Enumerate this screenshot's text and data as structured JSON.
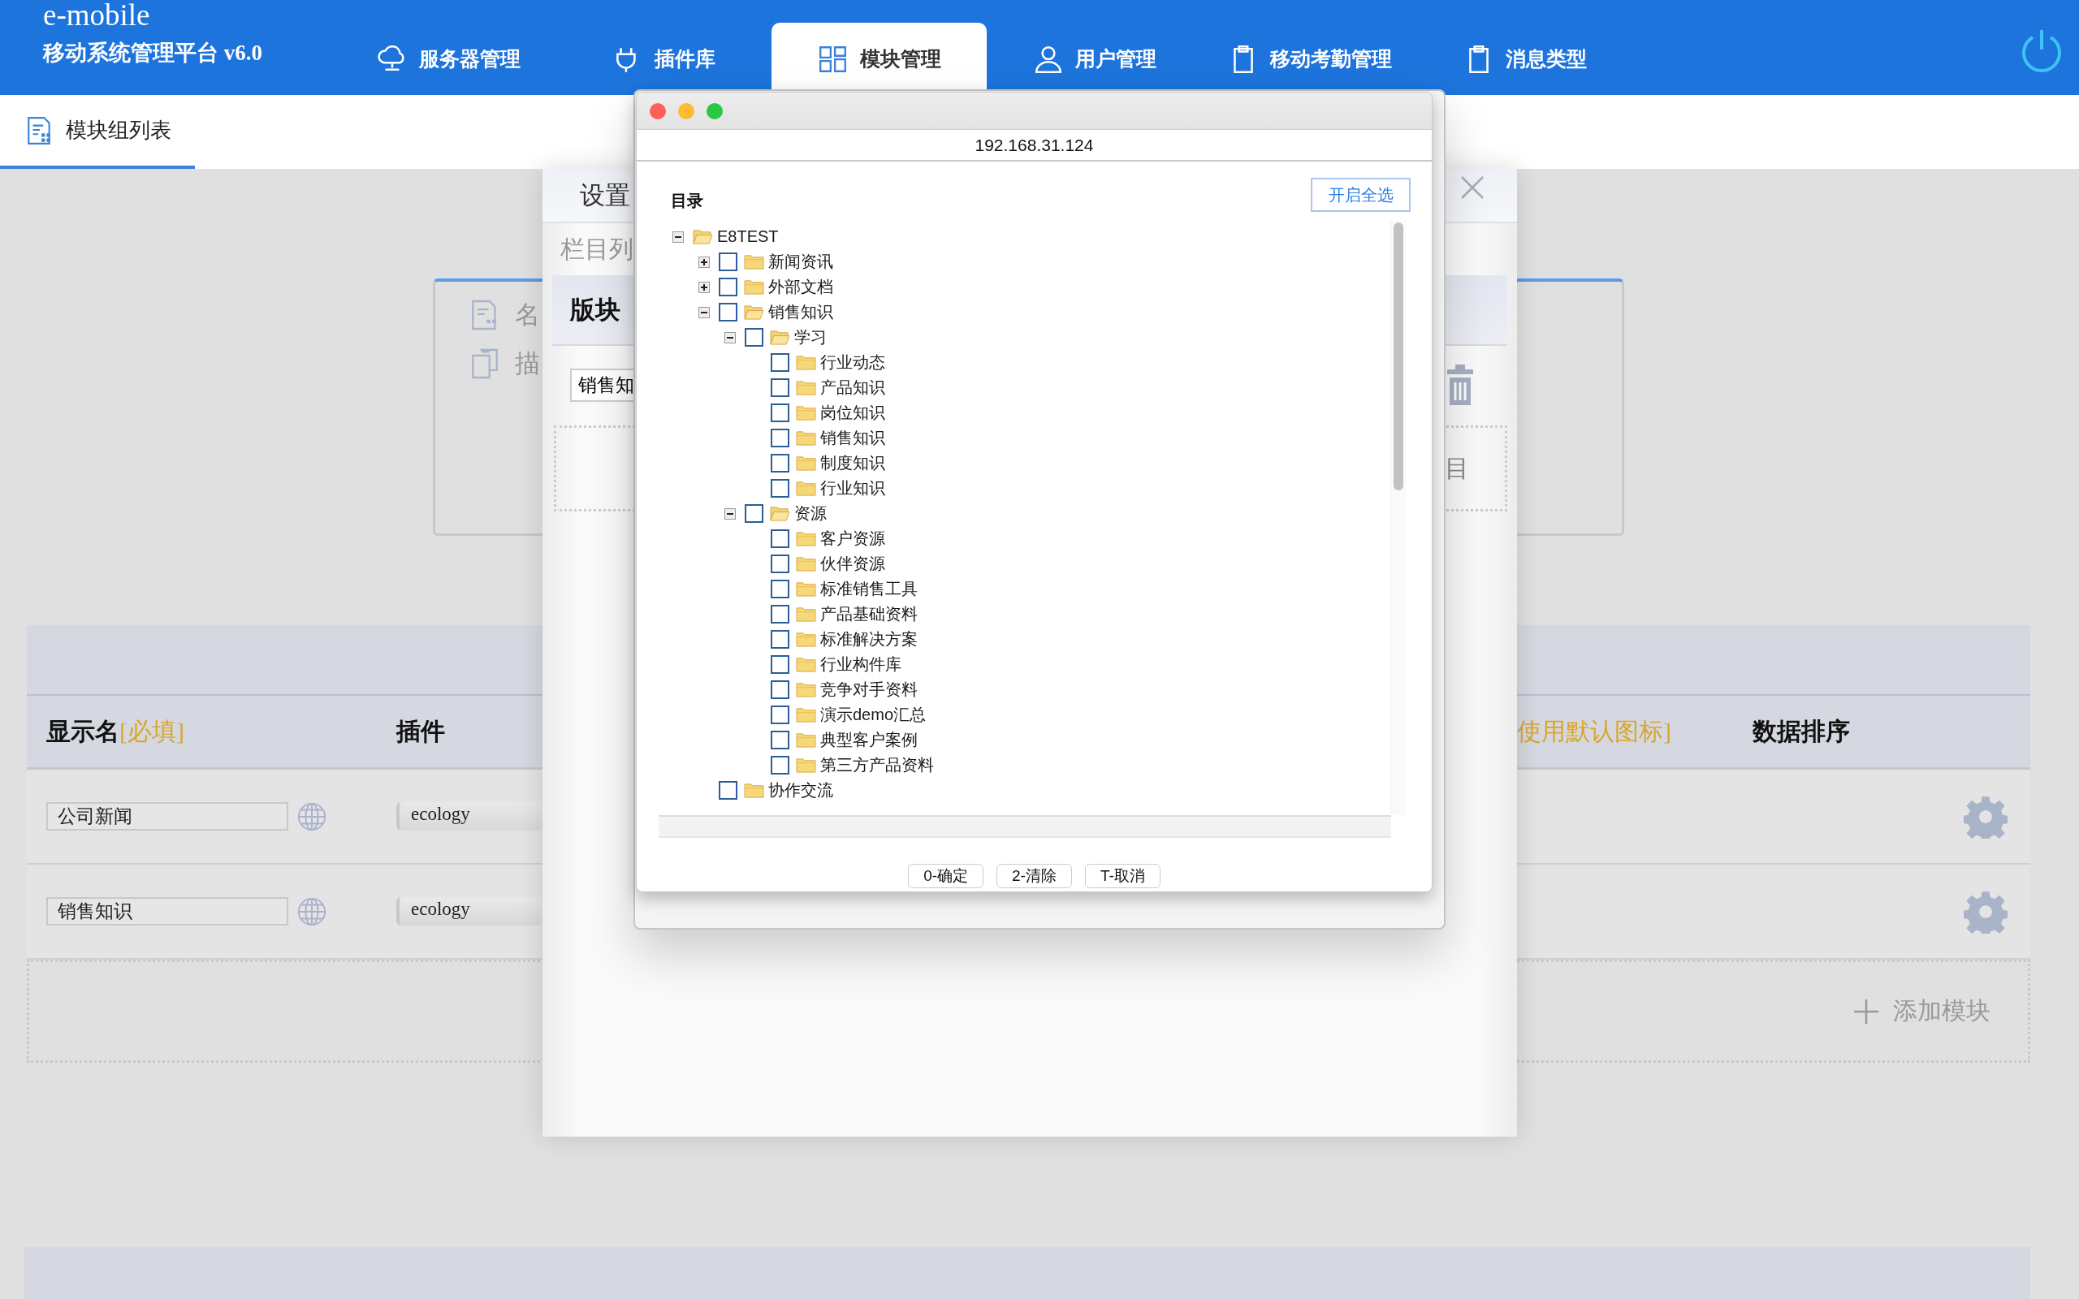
{
  "header": {
    "logo": "e-mobile",
    "subtitle": "移动系统管理平台 v6.0",
    "tabs": [
      {
        "label": "服务器管理",
        "selected": false
      },
      {
        "label": "插件库",
        "selected": false
      },
      {
        "label": "模块管理",
        "selected": true
      },
      {
        "label": "用户管理",
        "selected": false
      },
      {
        "label": "移动考勤管理",
        "selected": false
      },
      {
        "label": "消息类型",
        "selected": false
      }
    ]
  },
  "subnav": {
    "tabs": [
      {
        "label": "模块组列表",
        "selected": true
      }
    ]
  },
  "card": {
    "fields": [
      "名",
      "描"
    ]
  },
  "table": {
    "columns": [
      {
        "label": "显示名",
        "note": "[必填]"
      },
      {
        "label": "插件"
      },
      {
        "note": "使用默认图标]"
      },
      {
        "label": "数据排序"
      }
    ],
    "rows": [
      {
        "name": "公司新闻",
        "plugin": "ecology"
      },
      {
        "name": "销售知识",
        "plugin": "ecology"
      }
    ],
    "add_label": "添加模块"
  },
  "settings_panel": {
    "title": "设置",
    "section": "栏目列",
    "column_header": "版块",
    "input_value": "销售知",
    "side_text": "目"
  },
  "dialog": {
    "address": "192.168.31.124",
    "heading": "目录",
    "select_all": "开启全选",
    "tree": {
      "label": "E8TEST",
      "expanded": true,
      "children": [
        {
          "label": "新闻资讯",
          "expanded": false,
          "checked": false
        },
        {
          "label": "外部文档",
          "expanded": false,
          "checked": false
        },
        {
          "label": "销售知识",
          "expanded": true,
          "checked": false,
          "children": [
            {
              "label": "学习",
              "expanded": true,
              "checked": false,
              "children": [
                {
                  "label": "行业动态",
                  "checked": false
                },
                {
                  "label": "产品知识",
                  "checked": false
                },
                {
                  "label": "岗位知识",
                  "checked": false
                },
                {
                  "label": "销售知识",
                  "checked": false
                },
                {
                  "label": "制度知识",
                  "checked": false
                },
                {
                  "label": "行业知识",
                  "checked": false
                }
              ]
            },
            {
              "label": "资源",
              "expanded": true,
              "checked": false,
              "children": [
                {
                  "label": "客户资源",
                  "checked": false
                },
                {
                  "label": "伙伴资源",
                  "checked": false
                },
                {
                  "label": "标准销售工具",
                  "checked": false
                },
                {
                  "label": "产品基础资料",
                  "checked": false
                },
                {
                  "label": "标准解决方案",
                  "checked": false
                },
                {
                  "label": "行业构件库",
                  "checked": false
                },
                {
                  "label": "竞争对手资料",
                  "checked": false
                },
                {
                  "label": "演示demo汇总",
                  "checked": false
                },
                {
                  "label": "典型客户案例",
                  "checked": false
                },
                {
                  "label": "第三方产品资料",
                  "checked": false
                }
              ]
            }
          ]
        },
        {
          "label": "协作交流",
          "checked": false
        }
      ]
    },
    "buttons": [
      "0-确定",
      "2-清除",
      "T-取消"
    ]
  }
}
